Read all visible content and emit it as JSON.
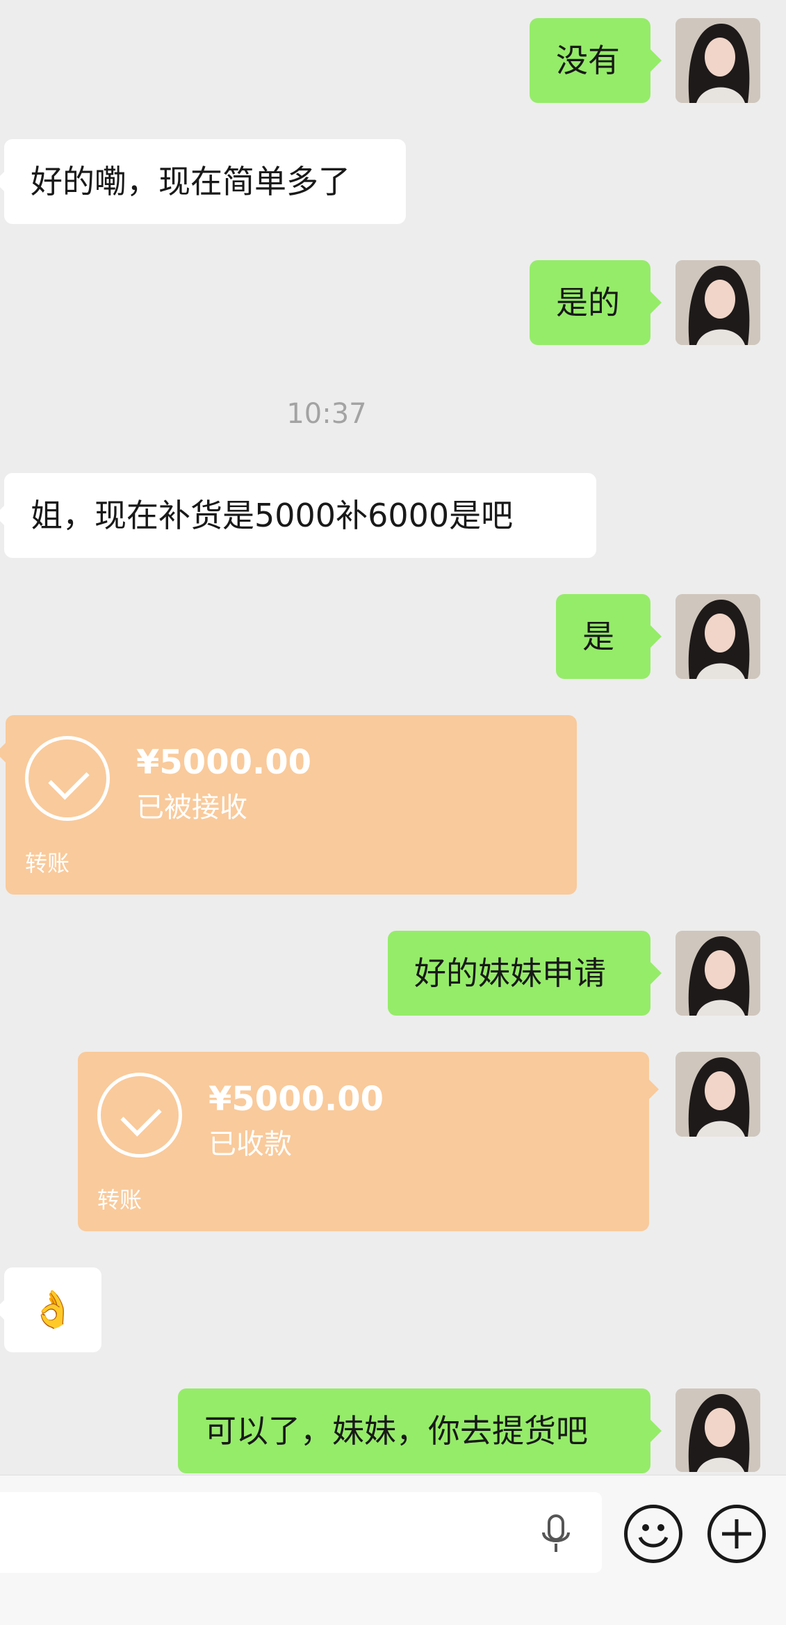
{
  "messages": {
    "m1": "没有",
    "m2": "好的嘞，现在简单多了",
    "m3": "是的",
    "time": "10:37",
    "m4": "姐，现在补货是5000补6000是吧",
    "m5": "是",
    "t1": {
      "amount": "¥5000.00",
      "status": "已被接收",
      "type": "转账"
    },
    "m6": "好的妹妹申请",
    "t2": {
      "amount": "¥5000.00",
      "status": "已收款",
      "type": "转账"
    },
    "m7": "👌",
    "m8": "可以了，妹妹，你去提货吧"
  },
  "colors": {
    "bg": "#ededed",
    "green_bubble": "#95ec69",
    "white_bubble": "#ffffff",
    "transfer": "#f9ca9b"
  },
  "icons": {
    "voice": "microphone-icon",
    "emoji": "smiley-icon",
    "more": "plus-icon"
  }
}
